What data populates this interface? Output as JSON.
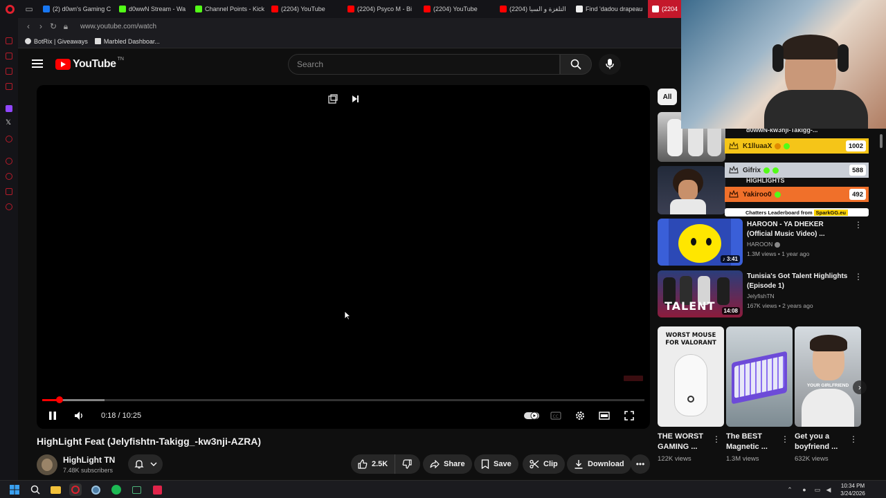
{
  "browser": {
    "tabs": [
      {
        "label": "(2) d0wn's Gaming C",
        "color": "#1877f2"
      },
      {
        "label": "d0wwN Stream - Wa",
        "color": "#53fc18"
      },
      {
        "label": "Channel Points - Kick",
        "color": "#53fc18"
      },
      {
        "label": "(2204) YouTube",
        "color": "#ff0000"
      },
      {
        "label": "(2204) Psyco M - Bi",
        "color": "#ff0000"
      },
      {
        "label": "(2204) YouTube",
        "color": "#ff0000"
      },
      {
        "label": "التلغزة و السيا (2204)",
        "color": "#ff0000"
      },
      {
        "label": "Find 'dadou drapeau",
        "color": "#eeeeee"
      },
      {
        "label": "(2204",
        "color": "#ff0000"
      }
    ],
    "url": "www.youtube.com/watch",
    "bookmarks": [
      {
        "label": "BotRix | Giveaways"
      },
      {
        "label": "Marbled Dashboar..."
      }
    ]
  },
  "youtube": {
    "logo_text": "YouTube",
    "country_code": "TN",
    "search_placeholder": "Search"
  },
  "player": {
    "current_time": "0:18",
    "duration": "10:25",
    "time_display": "0:18 / 10:25",
    "played_fraction": 0.029,
    "buffered_fraction": 0.103
  },
  "video": {
    "title": "HighLight Feat (Jelyfishtn-Takigg_-kw3nji-AZRA)",
    "channel": "HighLight TN",
    "subscribers": "7.48K subscribers",
    "likes": "2.5K",
    "share_label": "Share",
    "save_label": "Save",
    "clip_label": "Clip",
    "download_label": "Download"
  },
  "sidebar": {
    "chip_all": "All",
    "partial_title_1": "d0wwN-kw3nji-Takigg-...",
    "partial_title_2": "HIGHLIGHTS",
    "recommendations": [
      {
        "title": "HAROON  - YA DHEKER (Official Music Video) ...",
        "channel": "HAROON",
        "meta": "1.3M views • 1 year ago",
        "duration": "3:41"
      },
      {
        "title": "Tunisia's Got Talent Highlights (Episode 1)",
        "channel": "JelyfishTN",
        "meta": "167K views • 2 years ago",
        "duration": "14:08"
      }
    ],
    "shorts": [
      {
        "title": "THE WORST GAMING ...",
        "views": "122K views",
        "thumb_text": "WORST MOUSE FOR VALORANT"
      },
      {
        "title": "The BEST Magnetic ...",
        "views": "1.3M views",
        "thumb_text": ""
      },
      {
        "title": "Get you a boyfriend ...",
        "views": "632K views",
        "thumb_text": "YOUR GIRLFRIEND"
      }
    ]
  },
  "leaderboard": {
    "entries": [
      {
        "name": "K1lluaaX",
        "score": "1002",
        "color": "#f5c518"
      },
      {
        "name": "Gifrix",
        "score": "588",
        "color": "#c9ced6"
      },
      {
        "name": "Yakiroo0",
        "score": "492",
        "color": "#f0702a"
      }
    ],
    "footer": "Chatters Leaderboard from",
    "brand": "SparkGG.eu"
  },
  "taskbar": {
    "time": "10:34 PM",
    "date": "3/24/2026"
  }
}
